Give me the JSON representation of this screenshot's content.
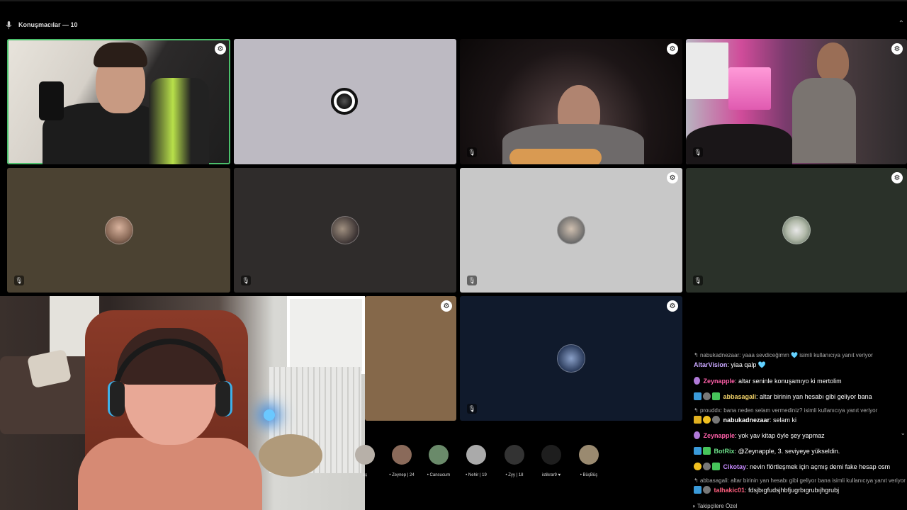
{
  "header": {
    "title": "Konuşmacılar — 10"
  },
  "icons": {
    "mic": "microphone-icon",
    "mute": "mic-off-icon",
    "settings": "gear-icon"
  },
  "audience": [
    {
      "name": "aş",
      "color": "#b7b0a8"
    },
    {
      "name": "• Zeynep | 24",
      "color": "#8a6a5a"
    },
    {
      "name": "• Cansucum",
      "color": "#6a8a6a"
    },
    {
      "name": "• Nehir | 19",
      "color": "#aaa"
    },
    {
      "name": "• Zyy | 18",
      "color": "#333"
    },
    {
      "name": "istikrar9 ♥",
      "color": "#1e1e1e"
    },
    {
      "name": "• BüşBüş",
      "color": "#9a8a70"
    }
  ],
  "chat": {
    "messages": [
      {
        "reply": "nabukadnezaar: yaaa sevdiceğimm 🩵 isimli kullanıcıya yanıt veriyor"
      },
      {
        "user": "AltarVision",
        "user_color": "#c9a7ff",
        "text": ": yiaa qalp 🩵"
      },
      {
        "user": "Zeynapple",
        "user_color": "#ff5fa8",
        "text": ": altar seninle konuşamıyo ki mertolim"
      },
      {
        "user": "abbasagali",
        "user_color": "#f3d36a",
        "text": ": altar birinin yan hesabı gibi geliyor bana"
      },
      {
        "reply": "prouddx: bana neden selam vermediniz? isimli kullanıcıya yanıt veriyor"
      },
      {
        "user": "nabukadnezaar",
        "user_color": "#ffffff",
        "text": ": selam ki"
      },
      {
        "user": "Zeynapple",
        "user_color": "#ff5fa8",
        "text": ": yok yav kitap öyle şey yapmaz"
      },
      {
        "user": "BotRix",
        "user_color": "#6de08a",
        "text": ": @Zeynapple, 3. seviyeye yükseldin."
      },
      {
        "user": "Cikotay",
        "user_color": "#c78aff",
        "text": ": nevin flörtleşmek için açmış demi fake hesap osm"
      },
      {
        "reply": "abbasagali: altar birinin yan hesabı gibi geliyor bana isimli kullanıcıya yanıt veriyor"
      },
      {
        "user": "talhakic01",
        "user_color": "#ff5f7e",
        "text": ": fdsjbıgfudsjhbfjugrbıgrubıjhgrubj"
      }
    ],
    "footer": "Takipçilere Özel"
  }
}
